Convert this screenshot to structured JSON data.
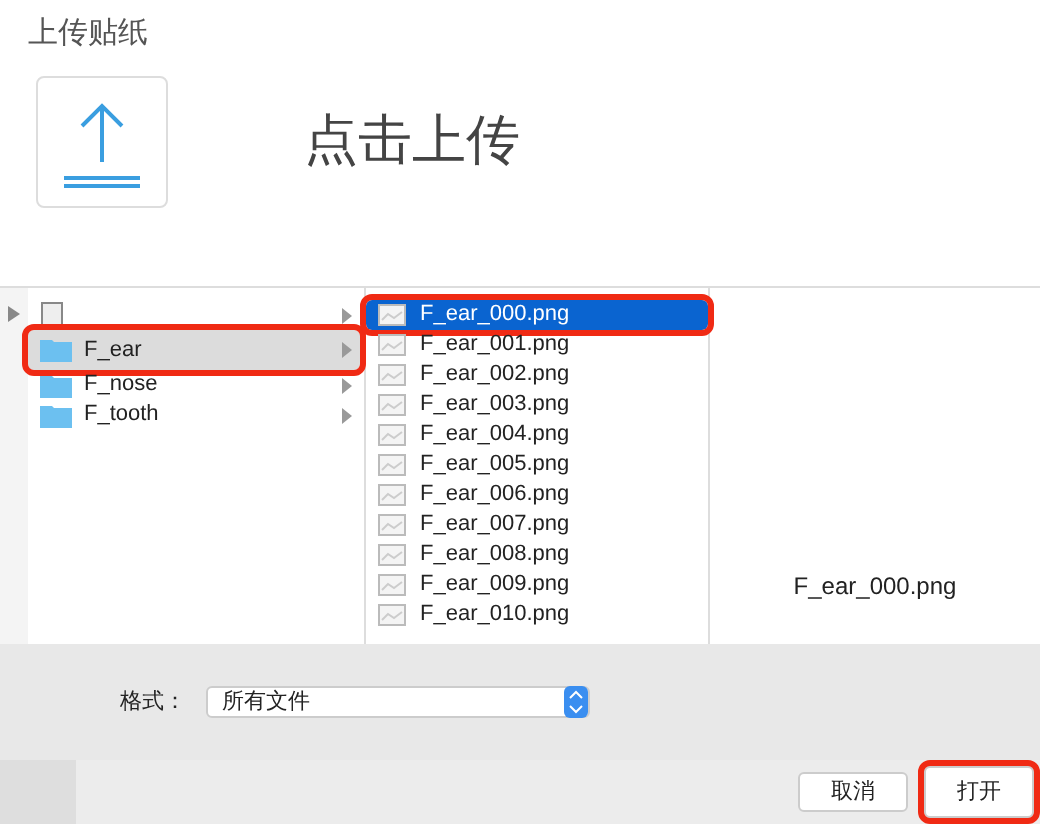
{
  "title": "上传贴纸",
  "upload": {
    "label": "点击上传"
  },
  "folders": [
    {
      "kind": "file",
      "selected": false,
      "highlighted": false,
      "has_children": true
    },
    {
      "name": "F_ear",
      "kind": "folder",
      "selected": true,
      "highlighted": true,
      "has_children": true
    },
    {
      "name": "F_nose",
      "kind": "folder",
      "selected": false,
      "highlighted": false,
      "has_children": true
    },
    {
      "name": "F_tooth",
      "kind": "folder",
      "selected": false,
      "highlighted": false,
      "has_children": true
    }
  ],
  "files": [
    {
      "name": "F_ear_000.png",
      "selected": true,
      "highlighted": true
    },
    {
      "name": "F_ear_001.png",
      "selected": false,
      "highlighted": false
    },
    {
      "name": "F_ear_002.png",
      "selected": false,
      "highlighted": false
    },
    {
      "name": "F_ear_003.png",
      "selected": false,
      "highlighted": false
    },
    {
      "name": "F_ear_004.png",
      "selected": false,
      "highlighted": false
    },
    {
      "name": "F_ear_005.png",
      "selected": false,
      "highlighted": false
    },
    {
      "name": "F_ear_006.png",
      "selected": false,
      "highlighted": false
    },
    {
      "name": "F_ear_007.png",
      "selected": false,
      "highlighted": false
    },
    {
      "name": "F_ear_008.png",
      "selected": false,
      "highlighted": false
    },
    {
      "name": "F_ear_009.png",
      "selected": false,
      "highlighted": false
    },
    {
      "name": "F_ear_010.png",
      "selected": false,
      "highlighted": false
    }
  ],
  "preview": {
    "filename": "F_ear_000.png"
  },
  "format": {
    "label": "格式：",
    "value": "所有文件"
  },
  "buttons": [
    {
      "label": "取消",
      "highlighted": false
    },
    {
      "label": "打开",
      "highlighted": true
    }
  ]
}
